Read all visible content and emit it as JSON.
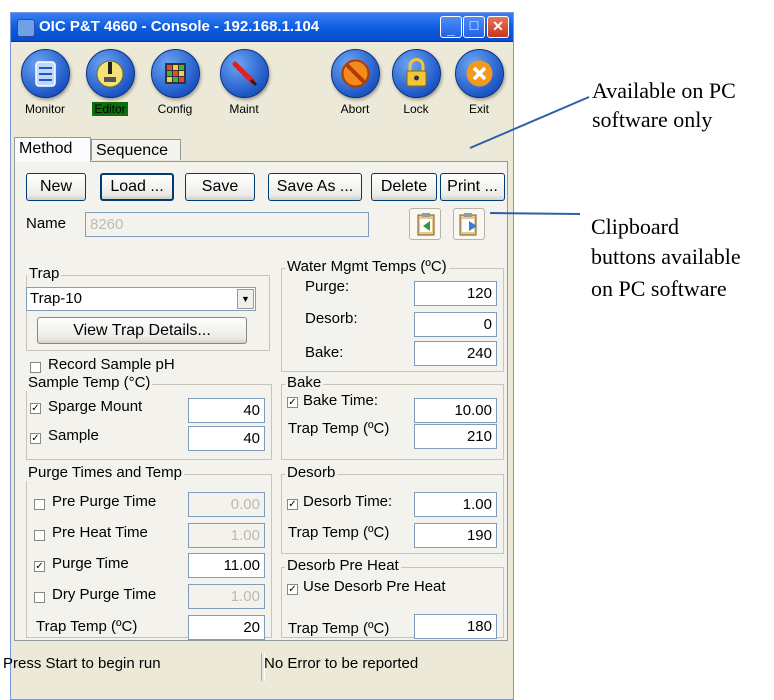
{
  "window": {
    "title": "OIC P&T 4660 - Console - 192.168.1.104"
  },
  "toolbar": {
    "items": [
      {
        "label": "Monitor",
        "icon": "monitor-icon"
      },
      {
        "label": "Editor",
        "icon": "editor-icon"
      },
      {
        "label": "Config",
        "icon": "config-icon"
      },
      {
        "label": "Maint",
        "icon": "maint-icon"
      },
      {
        "label": "Abort",
        "icon": "abort-icon"
      },
      {
        "label": "Lock",
        "icon": "lock-icon"
      },
      {
        "label": "Exit",
        "icon": "exit-icon"
      }
    ]
  },
  "tabs": [
    {
      "label": "Method",
      "active": true
    },
    {
      "label": "Sequence",
      "active": false
    }
  ],
  "actions": {
    "new": "New",
    "load": "Load ...",
    "save": "Save",
    "save_as": "Save As ...",
    "delete": "Delete",
    "print": "Print ..."
  },
  "name_field": {
    "label": "Name",
    "value": "8260"
  },
  "trap": {
    "group_title": "Trap",
    "selected": "Trap-10",
    "details_button": "View Trap Details..."
  },
  "record_ph": {
    "label": "Record Sample pH",
    "checked": false
  },
  "sample_temp": {
    "group_title": "Sample Temp (°C)",
    "rows": [
      {
        "label": "Sparge Mount",
        "checked": true,
        "value": "40"
      },
      {
        "label": "Sample",
        "checked": true,
        "value": "40"
      }
    ]
  },
  "purge": {
    "group_title": "Purge Times and Temp",
    "rows": [
      {
        "label": "Pre Purge Time",
        "checked": false,
        "value": "0.00",
        "enabled": false
      },
      {
        "label": "Pre Heat Time",
        "checked": false,
        "value": "1.00",
        "enabled": false
      },
      {
        "label": "Purge Time",
        "checked": true,
        "value": "11.00",
        "enabled": true
      },
      {
        "label": "Dry Purge Time",
        "checked": false,
        "value": "1.00",
        "enabled": false
      }
    ],
    "trap_temp_label": "Trap Temp (ºC)",
    "trap_temp_value": "20"
  },
  "water_mgmt": {
    "group_title": "Water Mgmt Temps (ºC)",
    "rows": [
      {
        "label": "Purge:",
        "value": "120"
      },
      {
        "label": "Desorb:",
        "value": "0"
      },
      {
        "label": "Bake:",
        "value": "240"
      }
    ]
  },
  "bake": {
    "group_title": "Bake",
    "time_label": "Bake Time:",
    "time_checked": true,
    "time_value": "10.00",
    "trap_temp_label": "Trap Temp (ºC)",
    "trap_temp_value": "210"
  },
  "desorb": {
    "group_title": "Desorb",
    "time_label": "Desorb Time:",
    "time_checked": true,
    "time_value": "1.00",
    "trap_temp_label": "Trap Temp (ºC)",
    "trap_temp_value": "190"
  },
  "desorb_preheat": {
    "group_title": "Desorb Pre Heat",
    "use_label": "Use Desorb Pre Heat",
    "use_checked": true,
    "trap_temp_label": "Trap Temp (ºC)",
    "trap_temp_value": "180"
  },
  "status": {
    "left": "Press Start to begin run",
    "right": "No Error to be reported"
  },
  "annotations": {
    "pc_only_line1": "Available on PC",
    "pc_only_line2": "software only",
    "clipboard_line1": "Clipboard",
    "clipboard_line2": "buttons available",
    "clipboard_line3": "on PC software"
  },
  "colors": {
    "titlebar": "#0A5BE0",
    "window_bg": "#ECE9D8",
    "annotation_line": "#2E5FA8"
  }
}
